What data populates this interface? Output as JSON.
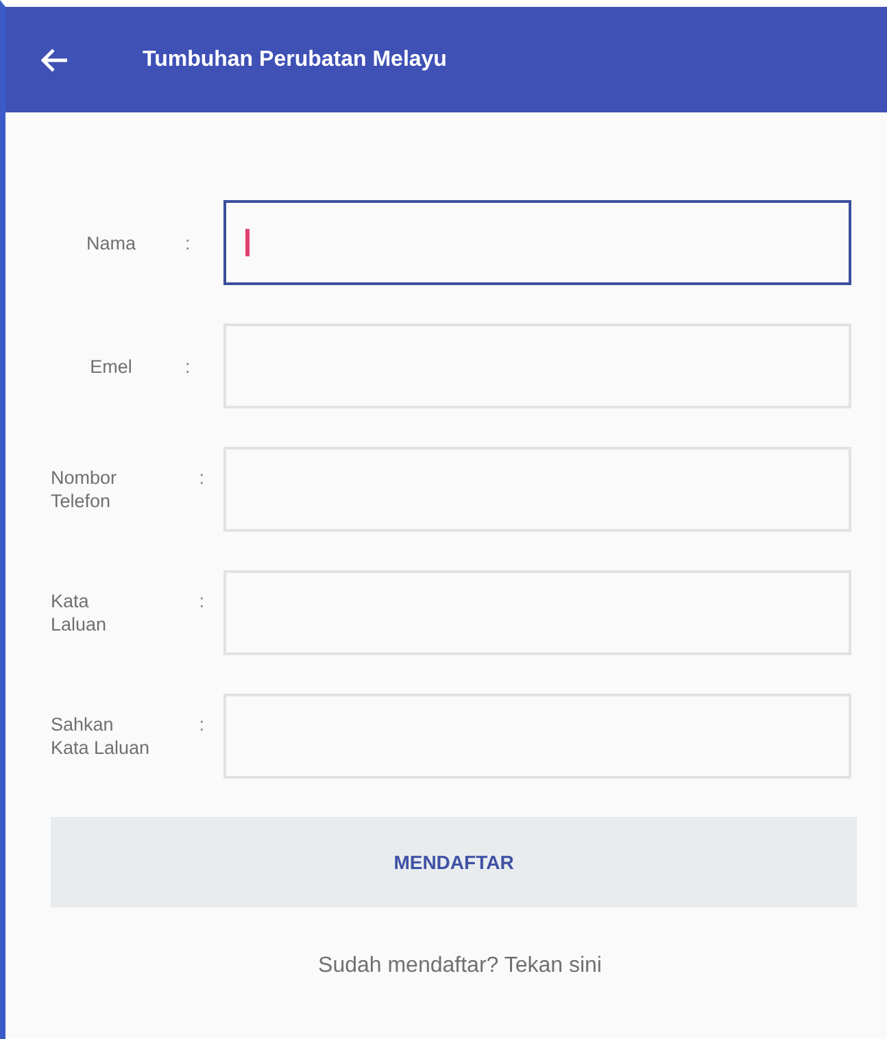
{
  "app_bar": {
    "title": "Tumbuhan Perubatan Melayu"
  },
  "fields": [
    {
      "label": "Nama",
      "colon": ":",
      "focused": true
    },
    {
      "label": "Emel",
      "colon": ":",
      "focused": false
    },
    {
      "label": "Nombor\nTelefon",
      "colon": ":",
      "focused": false
    },
    {
      "label": "Kata\nLaluan",
      "colon": ":",
      "focused": false
    },
    {
      "label": "Sahkan\nKata Laluan",
      "colon": ":",
      "focused": false
    }
  ],
  "submit_button": "MENDAFTAR",
  "login_link": "Sudah mendaftar? Tekan sini"
}
